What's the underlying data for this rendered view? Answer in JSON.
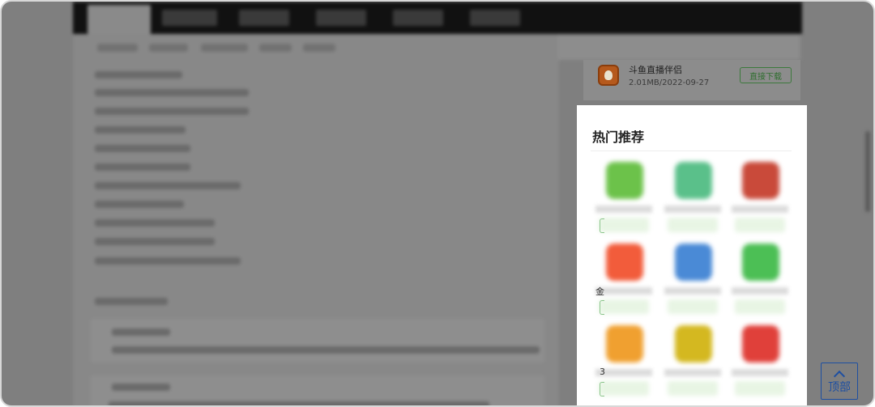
{
  "download_item": {
    "name": "斗鱼直播伴侣",
    "meta": "2.01MB/2022-09-27",
    "button_label": "直接下载"
  },
  "hot_panel": {
    "title": "热门推荐",
    "apps": [
      {
        "icon": "green-app-icon",
        "color": "#6cc24a"
      },
      {
        "icon": "green-purple-app-icon",
        "color": "#5ac08a"
      },
      {
        "icon": "avatar-app-icon",
        "color": "#c94a3a"
      },
      {
        "icon": "orange-app-icon",
        "color": "#f25c3b"
      },
      {
        "icon": "cartoon-app-icon",
        "color": "#4a8ad6"
      },
      {
        "icon": "wechat-like-app-icon",
        "color": "#4cbf55"
      },
      {
        "icon": "colorful-app-icon",
        "color": "#f0a030"
      },
      {
        "icon": "yellow-app-icon",
        "color": "#d4b820"
      },
      {
        "icon": "red-app-icon",
        "color": "#e0403a"
      }
    ],
    "edge_glyphs": [
      "金",
      "3"
    ]
  },
  "back_to_top": {
    "label": "顶部"
  }
}
